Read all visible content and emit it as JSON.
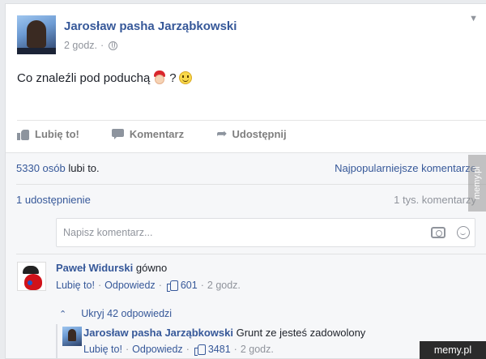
{
  "post": {
    "author": "Jarosław pasha Jarząbkowski",
    "time": "2 godz.",
    "separator": "·",
    "text": "Co znaleźli pod poduchą",
    "question_mark": "?"
  },
  "actions": {
    "like": "Lubię to!",
    "comment": "Komentarz",
    "share": "Udostępnij"
  },
  "stats": {
    "likes_count": "5330 osób",
    "likes_suffix": " lubi to.",
    "sort_label": "Najpopularniejsze komentarze",
    "shares": "1 udostępnienie",
    "comments_count": "1 tys. komentarzy"
  },
  "comment_box": {
    "placeholder": "Napisz komentarz..."
  },
  "comments": [
    {
      "author": "Paweł Widurski",
      "text": "gówno",
      "like": "Lubię to!",
      "reply": "Odpowiedz",
      "likes": "601",
      "time": "2 godz."
    }
  ],
  "replies_toggle": "Ukryj 42 odpowiedzi",
  "replies": [
    {
      "author": "Jarosław pasha Jarząbkowski",
      "text": "Grunt ze jesteś zadowolony",
      "like": "Lubię to!",
      "reply": "Odpowiedz",
      "likes": "3481",
      "time": "2 godz."
    }
  ],
  "watermarks": {
    "side": "memy.pl",
    "corner": "memy.pl"
  },
  "icons": {
    "globe": "globe-icon",
    "like": "thumbs-up-icon",
    "comment": "speech-bubble-icon",
    "share": "share-arrow-icon",
    "camera": "camera-icon",
    "emoji": "smiley-icon"
  },
  "colors": {
    "link": "#365899",
    "muted": "#90949c",
    "background": "#e9ebee"
  }
}
